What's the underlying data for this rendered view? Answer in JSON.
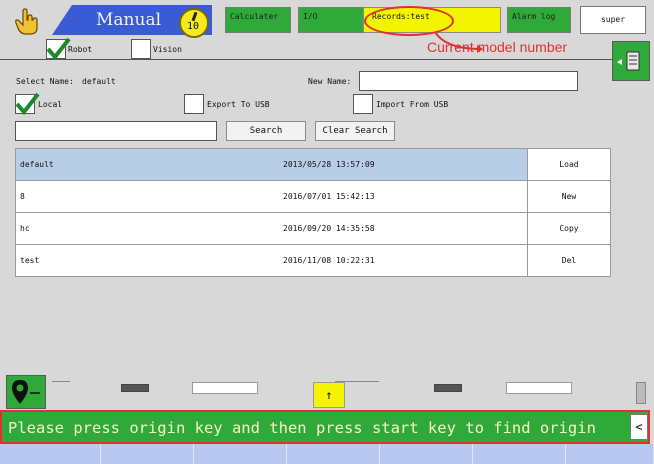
{
  "header": {
    "mode_label": "Manual",
    "speed_value": "10",
    "calculator_label": "Calculater",
    "io_label": "I/O",
    "records_label": "Records:test",
    "alarm_log_label": "Alarm log",
    "user_label": "super",
    "annotation": "Current model number"
  },
  "subtabs": {
    "robot_label": "Robot",
    "vision_label": "Vision"
  },
  "form": {
    "select_name_label": "Select Name:",
    "select_name_value": "default",
    "new_name_label": "New Name:",
    "new_name_value": "",
    "local_label": "Local",
    "export_label": "Export To USB",
    "import_label": "Import From USB",
    "search_value": "",
    "search_label": "Search",
    "clear_search_label": "Clear Search"
  },
  "records": [
    {
      "name": "default",
      "date": "2013/05/28 13:57:09",
      "action": "Load"
    },
    {
      "name": "8",
      "date": "2016/07/01 15:42:13",
      "action": "New"
    },
    {
      "name": "hc",
      "date": "2016/09/20 14:35:58",
      "action": "Copy"
    },
    {
      "name": "test",
      "date": "2016/11/08 10:22:31",
      "action": "Del"
    }
  ],
  "status": {
    "message": "Please press origin key and then press start key to find origin",
    "up_arrow": "↑",
    "collapse": "<"
  },
  "colors": {
    "accent_green": "#2faa3a",
    "mode_blue": "#3a5bd6",
    "records_yellow": "#f4f400",
    "annotation_red": "#e03030",
    "selected_row": "#b8cde6",
    "bottom_bar": "#b8c8f0"
  }
}
